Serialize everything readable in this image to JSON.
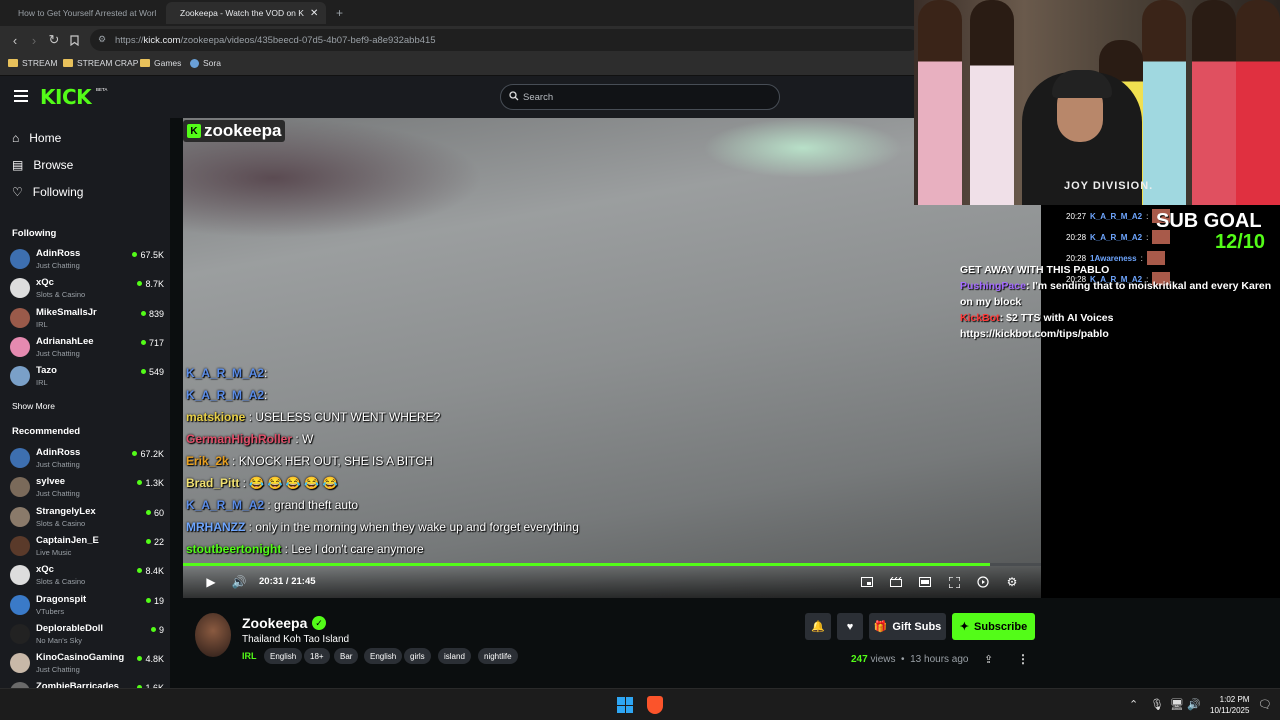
{
  "browser": {
    "tabs": [
      {
        "title": "How to Get Yourself Arrested at Worl",
        "favicon": "youtube-icon"
      },
      {
        "title": "Zookeepa - Watch the VOD on K",
        "favicon": "kick-icon",
        "active": true
      }
    ],
    "url_prefix": "https://",
    "url_host": "kick.com",
    "url_path": "/zookeepa/videos/435beecd-07d5-4b07-bef9-a8e932abb415",
    "bookmarks": [
      "STREAM",
      "STREAM CRAP",
      "Games",
      "Sora"
    ]
  },
  "kick": {
    "logo": "KICK",
    "beta": "BETA",
    "search_placeholder": "Search"
  },
  "sidebar": {
    "nav": [
      "Home",
      "Browse",
      "Following"
    ],
    "following_title": "Following",
    "following": [
      {
        "name": "AdinRoss",
        "category": "Just Chatting",
        "viewers": "67.5K",
        "color": "#3d6fb0"
      },
      {
        "name": "xQc",
        "category": "Slots & Casino",
        "viewers": "8.7K",
        "color": "#dddddd"
      },
      {
        "name": "MikeSmallsJr",
        "category": "IRL",
        "viewers": "839",
        "color": "#9a5a4a"
      },
      {
        "name": "AdrianahLee",
        "category": "Just Chatting",
        "viewers": "717",
        "color": "#e58ab0"
      },
      {
        "name": "Tazo",
        "category": "IRL",
        "viewers": "549",
        "color": "#7aa0c8"
      }
    ],
    "show_more": "Show More",
    "recommended_title": "Recommended",
    "recommended": [
      {
        "name": "AdinRoss",
        "category": "Just Chatting",
        "viewers": "67.2K",
        "color": "#3d6fb0"
      },
      {
        "name": "sylvee",
        "category": "Just Chatting",
        "viewers": "1.3K",
        "color": "#7a6a5a"
      },
      {
        "name": "StrangelyLex",
        "category": "Slots & Casino",
        "viewers": "60",
        "color": "#8a7a6a"
      },
      {
        "name": "CaptainJen_E",
        "category": "Live Music",
        "viewers": "22",
        "color": "#5a3a2a"
      },
      {
        "name": "xQc",
        "category": "Slots & Casino",
        "viewers": "8.4K",
        "color": "#dddddd"
      },
      {
        "name": "Dragonspit",
        "category": "VTubers",
        "viewers": "19",
        "color": "#3a7ac8"
      },
      {
        "name": "DeplorableDoll",
        "category": "No Man's Sky",
        "viewers": "9",
        "color": "#222222"
      },
      {
        "name": "KinoCasinoGaming",
        "category": "Just Chatting",
        "viewers": "4.8K",
        "color": "#c8b8a8"
      },
      {
        "name": "ZombieBarricades",
        "category": "",
        "viewers": "1.6K",
        "color": "#6a6a6a"
      }
    ]
  },
  "video": {
    "watermark": "zookeepa",
    "time": "20:31 / 21:45",
    "progress": 0.94,
    "overlay_chat": [
      {
        "user": "K_A_R_M_A2",
        "msg": ":",
        "color": "#5b8ce6"
      },
      {
        "user": "K_A_R_M_A2",
        "msg": ":",
        "color": "#5b8ce6"
      },
      {
        "user": "matskione",
        "msg": " : USELESS CUNT WENT WHERE?",
        "color": "#e8d048"
      },
      {
        "user": "GermanHighRoller",
        "msg": " : W",
        "color": "#e0506a"
      },
      {
        "user": "Erik_2k",
        "msg": " : KNOCK HER OUT, SHE IS A BITCH",
        "color": "#e8a020"
      },
      {
        "user": "Brad_Pitt",
        "msg": " : 😂 😂 😂 😂 😂",
        "color": "#f0e070"
      },
      {
        "user": "K_A_R_M_A2",
        "msg": " : grand theft auto",
        "color": "#5b8ce6"
      },
      {
        "user": "MRHANZZ",
        "msg": " : only in the morning when they wake up and forget everything",
        "color": "#6ea6ff"
      },
      {
        "user": "stoutbeertonight",
        "msg": " : Lee I don't care anymore",
        "color": "#53fc18"
      }
    ]
  },
  "overlay": {
    "sub_goal_label": "SUB GOAL",
    "sub_goal_value": "12/10",
    "chat": [
      {
        "time": "20:27",
        "user": "K_A_R_M_A2",
        "msg": ":"
      },
      {
        "time": "20:28",
        "user": "K_A_R_M_A2",
        "msg": ":"
      },
      {
        "time": "20:28",
        "user": "1Awareness",
        "msg": ":"
      },
      {
        "time": "20:28",
        "user": "K_A_R_M_A2",
        "msg": ":"
      }
    ],
    "alert_line1": "GET AWAY WITH THIS PABLO",
    "alert_user": "PushingPace",
    "alert_line2": ": I'm sending that to moiskritikal and every Karen on my block",
    "alert_bot": "KickBot",
    "alert_line3": ": $2 TTS with AI Voices",
    "alert_line4": "https://kickbot.com/tips/pablo"
  },
  "stream": {
    "name": "Zookeepa",
    "title": "Thailand Koh Tao Island",
    "category": "IRL",
    "tags": [
      "English",
      "18+",
      "Bar",
      "English",
      "girls",
      "island",
      "nightlife"
    ],
    "views": "247",
    "views_label": "views",
    "ago": "13 hours ago",
    "gift_label": "Gift Subs",
    "subscribe_label": "Subscribe"
  },
  "taskbar": {
    "time": "1:02 PM",
    "date": "10/11/2025"
  },
  "colors": {
    "accent": "#53fc18",
    "bg": "#0b0e0f",
    "panel": "#191b1f"
  }
}
